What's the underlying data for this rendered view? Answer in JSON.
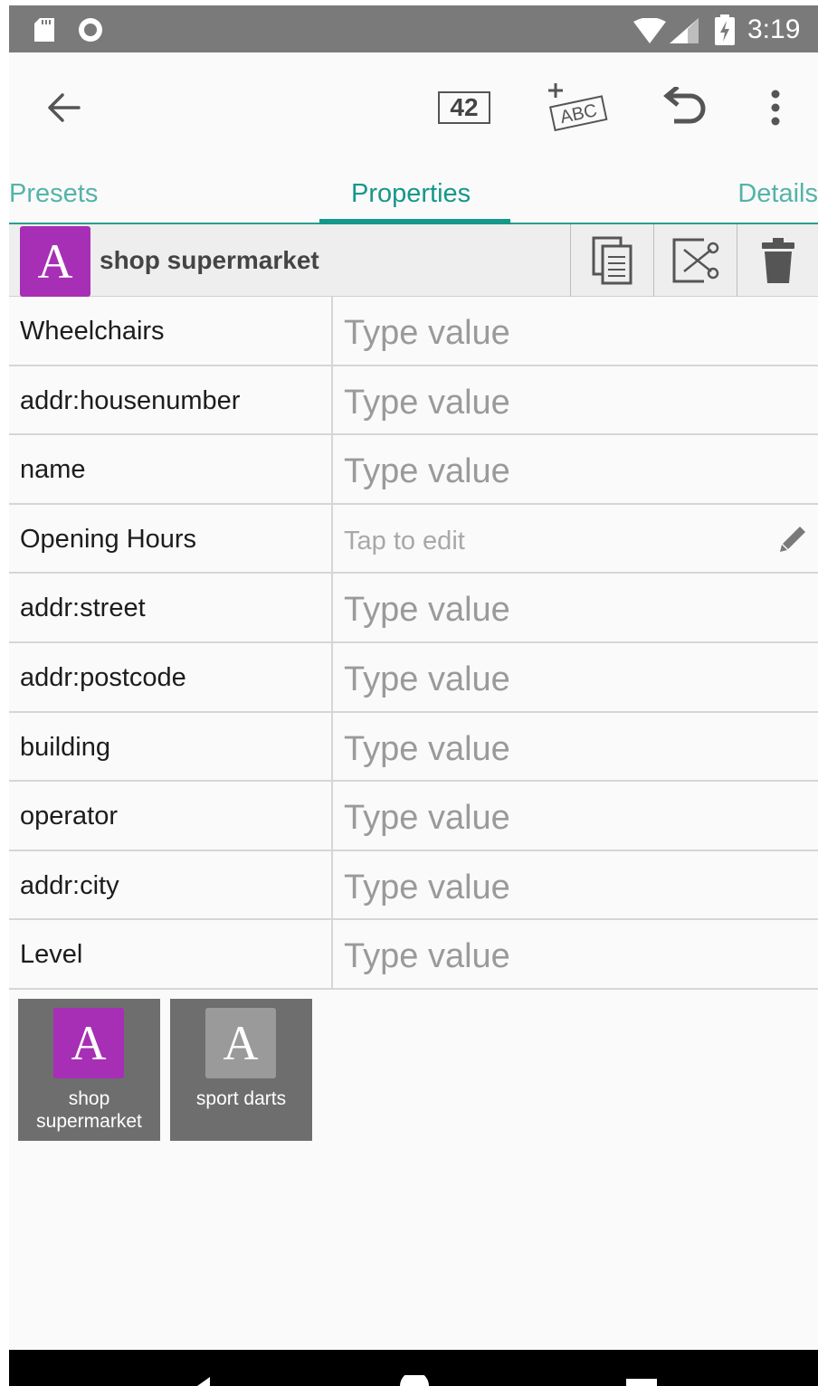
{
  "status_bar": {
    "time": "3:19"
  },
  "toolbar": {
    "number_badge": "42",
    "abc_label": "ABC"
  },
  "tabs": [
    {
      "label": "Presets"
    },
    {
      "label": "Properties"
    },
    {
      "label": "Details"
    }
  ],
  "preset_header": {
    "badge_letter": "A",
    "title": "shop supermarket"
  },
  "properties": [
    {
      "key": "Wheelchairs",
      "placeholder": "Type value"
    },
    {
      "key": "addr:housenumber",
      "placeholder": "Type value"
    },
    {
      "key": "name",
      "placeholder": "Type value"
    },
    {
      "key": "Opening Hours",
      "placeholder": "Tap to edit"
    },
    {
      "key": "addr:street",
      "placeholder": "Type value"
    },
    {
      "key": "addr:postcode",
      "placeholder": "Type value"
    },
    {
      "key": "building",
      "placeholder": "Type value"
    },
    {
      "key": "operator",
      "placeholder": "Type value"
    },
    {
      "key": "addr:city",
      "placeholder": "Type value"
    },
    {
      "key": "Level",
      "placeholder": "Type value"
    }
  ],
  "preset_suggestions": [
    {
      "letter": "A",
      "label": "shop supermarket"
    },
    {
      "letter": "A",
      "label": "sport darts"
    }
  ],
  "colors": {
    "accent": "#15978a",
    "preset_badge": "#a72fb5",
    "status_bar": "#7a7a7a"
  }
}
